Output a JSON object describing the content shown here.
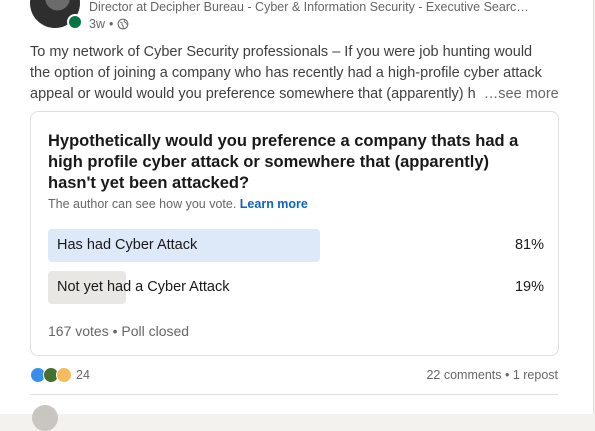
{
  "author": {
    "headline": "Director at Decipher Bureau - Cyber & Information Security - Executive Searc…",
    "time": "3w",
    "separator": "•",
    "presence_color": "#057642",
    "visibility_icon": "globe-icon"
  },
  "post": {
    "lines": [
      "To my network of Cyber Security professionals – If you were job hunting would",
      "the option of joining a company who has recently had a high-profile cyber attack",
      "appeal or would would you preference somewhere that (apparently) h"
    ],
    "see_more": "…see more"
  },
  "poll": {
    "question": "Hypothetically would you preference a company thats had a high profile cyber attack or somewhere that (apparently) hasn't yet been attacked?",
    "note": "The author can see how you vote.",
    "learn_more": "Learn more",
    "options": [
      {
        "label": "Has had Cyber Attack",
        "percent_text": "81%",
        "percent": 0.81
      },
      {
        "label": "Not yet had a Cyber Attack",
        "percent_text": "19%",
        "percent": 0.19
      }
    ],
    "footer": "167 votes • Poll closed"
  },
  "social": {
    "reaction_icons": [
      "like-icon",
      "celebrate-icon",
      "insightful-icon"
    ],
    "reaction_count": "24",
    "comments_reposts": "22 comments • 1 repost"
  },
  "colors": {
    "accent": "#0a66c2",
    "bar_selected": "#dde9f8",
    "bar_other": "#e9e7e3"
  }
}
